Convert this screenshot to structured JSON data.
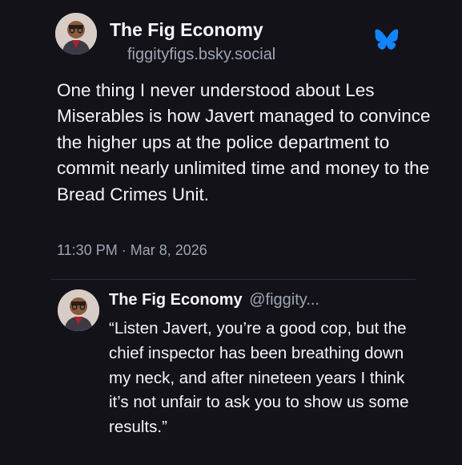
{
  "post": {
    "author_name": "The Fig Economy",
    "author_handle": "figgityfigs.bsky.social",
    "text": "One thing I never understood about Les Miserables is how Javert managed to convince the higher ups at the police department to commit nearly unlimited time and money to the Bread Crimes Unit.",
    "timestamp": "11:30 PM · Mar 8, 2026",
    "platform_icon": "bluesky-butterfly-icon",
    "accent_color": "#1185fe"
  },
  "reply": {
    "author_name": "The Fig Economy",
    "author_handle": "@figgity...",
    "text": "“Listen Javert, you’re a good cop, but the chief inspector has been breathing down my neck, and after nineteen years I think it’s not unfair to ask you to show us some results.”"
  },
  "colors": {
    "background": "#121218",
    "primary_text": "#f4f5f8",
    "secondary_text": "#9ea5b3"
  }
}
